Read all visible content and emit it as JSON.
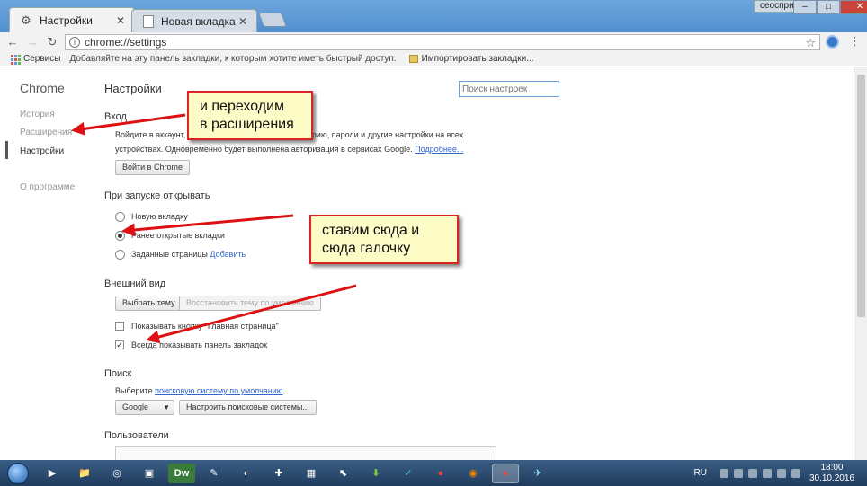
{
  "tabs": [
    {
      "label": "Настройки",
      "active": true
    },
    {
      "label": "Новая вкладка",
      "active": false
    }
  ],
  "window": {
    "user_badge": "сеоспринт",
    "minimize": "–",
    "maximize": "□",
    "close": "✕"
  },
  "toolbar": {
    "url": "chrome://settings"
  },
  "bookmarks": {
    "services_label": "Сервисы",
    "prompt": "Добавляйте на эту панель закладки, к которым хотите иметь быстрый доступ.",
    "import_label": "Импортировать закладки..."
  },
  "sidebar": {
    "brand": "Chrome",
    "items": [
      {
        "label": "История"
      },
      {
        "label": "Расширения"
      },
      {
        "label": "Настройки"
      },
      {
        "label": "О программе"
      }
    ]
  },
  "main": {
    "title": "Настройки",
    "search_placeholder": "Поиск настроек",
    "signin": {
      "heading": "Вход",
      "text_line1_a": "Войдите в аккаунт, ч",
      "text_line1_b": "сторию, пароли и другие настройки на всех",
      "text_line2": "устройствах. Одновременно будет выполнена авторизация в сервисах Google.",
      "more_link": "Подробнее...",
      "button": "Войти в Chrome"
    },
    "startup": {
      "heading": "При запуске открывать",
      "options": [
        {
          "label": "Новую вкладку",
          "checked": false
        },
        {
          "label": "Ранее открытые вкладки",
          "checked": true
        },
        {
          "label": "Заданные страницы",
          "checked": false
        }
      ],
      "add_link": "Добавить"
    },
    "appearance": {
      "heading": "Внешний вид",
      "theme_button": "Выбрать тему",
      "reset_button": "Восстановить тему по умолчанию",
      "home_checkbox": "Показывать кнопку \"Главная страница\"",
      "home_checked": false,
      "bookmarks_checkbox": "Всегда показывать панель закладок",
      "bookmarks_checked": true
    },
    "search": {
      "heading": "Поиск",
      "text_prefix": "Выберите",
      "engine_link": "поисковую систему по умолчанию",
      "text_suffix": ".",
      "engine_value": "Google",
      "manage_button": "Настроить поисковые системы..."
    },
    "users": {
      "heading": "Пользователи"
    }
  },
  "callouts": {
    "extensions": {
      "line1": "и переходим",
      "line2": "в расширения"
    },
    "checkmarks": {
      "line1": "ставим сюда и",
      "line2": "сюда галочку"
    }
  },
  "taskbar": {
    "apps": [
      "▶",
      "📁",
      "◎",
      "▣",
      "Dw",
      "✎",
      "◐",
      "✚",
      "▦",
      "⬉",
      "⬇",
      "✓",
      "●",
      "◉",
      "●",
      "✈"
    ],
    "language": "RU",
    "time": "18:00",
    "date": "30.10.2016"
  },
  "colors": {
    "accent": "#3366cc",
    "callout_bg": "#fdfbc6",
    "callout_border": "#dd2222",
    "arrow": "#dd1111"
  }
}
